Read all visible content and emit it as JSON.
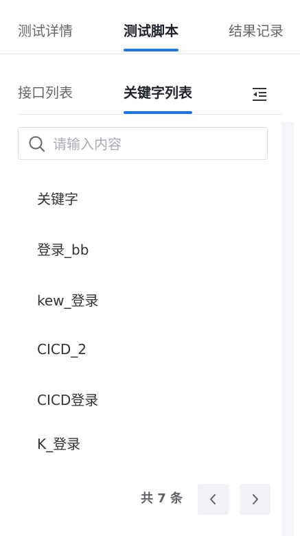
{
  "top_tabs": [
    {
      "label": "测试详情",
      "active": false
    },
    {
      "label": "测试脚本",
      "active": true
    },
    {
      "label": "结果记录",
      "active": false
    }
  ],
  "sub_tabs": [
    {
      "label": "接口列表",
      "active": false
    },
    {
      "label": "关键字列表",
      "active": true
    }
  ],
  "collapse_icon": "indent-decrease-icon",
  "search": {
    "placeholder": "请输入内容",
    "value": "",
    "icon": "search-icon"
  },
  "keywords": [
    "关键字",
    "登录_bb",
    "kew_登录",
    "CICD_2",
    "CICD登录",
    "K_登录"
  ],
  "pagination": {
    "total_text": "共 7 条",
    "prev_icon": "chevron-left-icon",
    "next_icon": "chevron-right-icon"
  },
  "colors": {
    "accent": "#1a73e8",
    "text": "#333333",
    "muted": "#666666",
    "border": "#e6e6e6"
  }
}
